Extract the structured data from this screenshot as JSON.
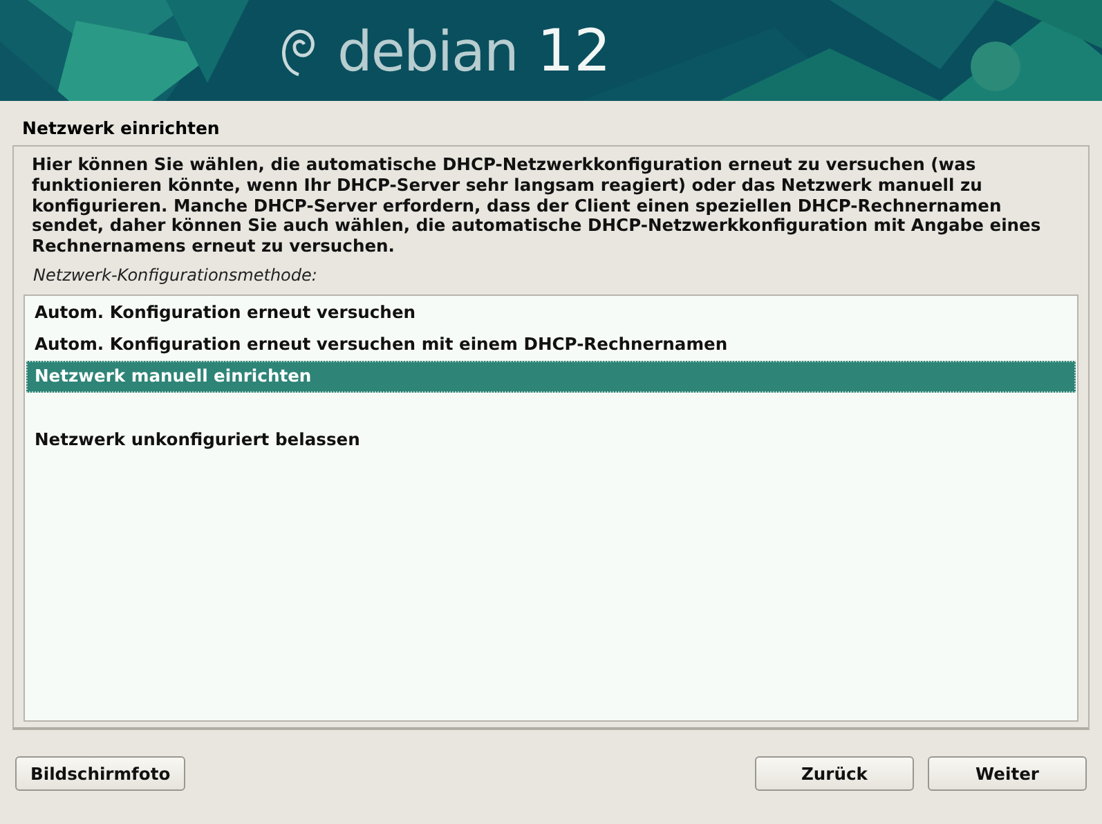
{
  "banner": {
    "brand": "debian",
    "version": "12"
  },
  "title": "Netzwerk einrichten",
  "description": "Hier können Sie wählen, die automatische DHCP-Netzwerkkonfiguration erneut zu versuchen (was funktionieren könnte, wenn Ihr DHCP-Server sehr langsam reagiert) oder das Netzwerk manuell zu konfigurieren. Manche DHCP-Server erfordern, dass der Client einen speziellen DHCP-Rechnernamen sendet, daher können Sie auch wählen, die automatische DHCP-Netzwerkkonfiguration mit Angabe eines Rechnernamens erneut zu versuchen.",
  "list_label": "Netzwerk-Konfigurationsmethode:",
  "options": [
    {
      "kind": "option",
      "label": "Autom. Konfiguration erneut versuchen",
      "selected": false
    },
    {
      "kind": "option",
      "label": "Autom. Konfiguration erneut versuchen mit einem DHCP-Rechnernamen",
      "selected": false
    },
    {
      "kind": "option",
      "label": "Netzwerk manuell einrichten",
      "selected": true
    },
    {
      "kind": "blank"
    },
    {
      "kind": "option",
      "label": "Netzwerk unkonfiguriert belassen",
      "selected": false
    }
  ],
  "buttons": {
    "left": [
      "Bildschirmfoto"
    ],
    "right": [
      "Zurück",
      "Weiter"
    ]
  }
}
